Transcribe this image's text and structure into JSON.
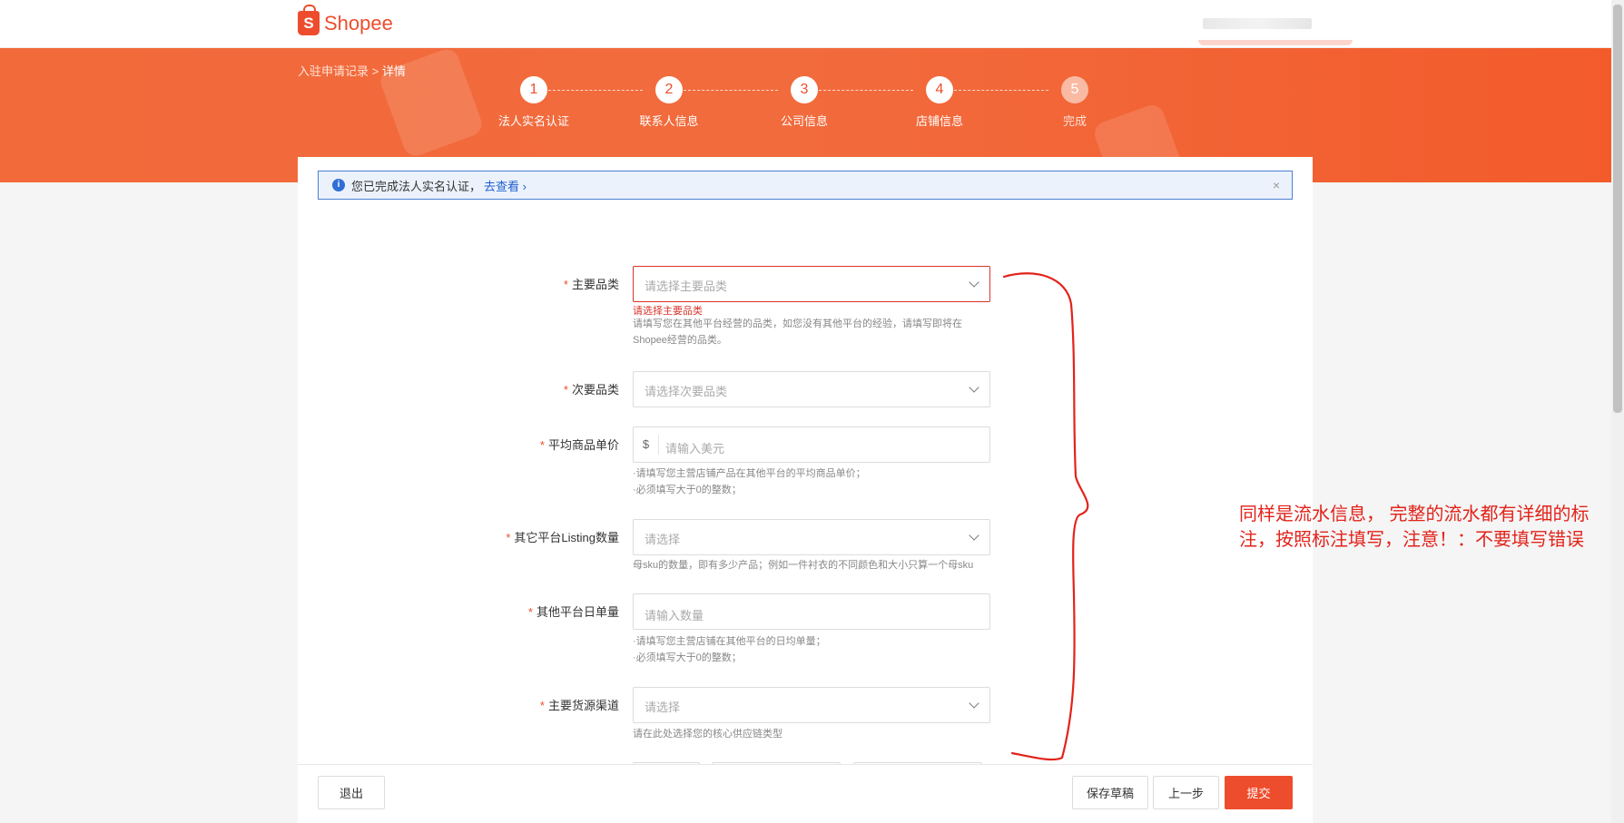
{
  "header": {
    "brand": "Shopee",
    "logo_letter": "S"
  },
  "breadcrumb": {
    "parent": "入驻申请记录",
    "separator": ">",
    "current": "详情"
  },
  "steps": [
    {
      "number": "1",
      "label": "法人实名认证"
    },
    {
      "number": "2",
      "label": "联系人信息"
    },
    {
      "number": "3",
      "label": "公司信息"
    },
    {
      "number": "4",
      "label": "店铺信息"
    },
    {
      "number": "5",
      "label": "完成"
    }
  ],
  "notice": {
    "icon": "info-icon",
    "text": "您已完成法人实名认证，",
    "link": "去查看",
    "link_arrow": "›",
    "close": "×"
  },
  "form": {
    "required_mark": "*",
    "main_category": {
      "label": "主要品类",
      "placeholder": "请选择主要品类",
      "error": "请选择主要品类",
      "hint": "请填写您在其他平台经营的品类，如您没有其他平台的经验，请填写即将在Shopee经营的品类。"
    },
    "secondary_category": {
      "label": "次要品类",
      "placeholder": "请选择次要品类"
    },
    "avg_price": {
      "label": "平均商品单价",
      "prefix": "$",
      "placeholder": "请输入美元",
      "hint1": "·请填写您主营店铺产品在其他平台的平均商品单价；",
      "hint2": "·必须填写大于0的整数；"
    },
    "listing_count": {
      "label": "其它平台Listing数量",
      "placeholder": "请选择",
      "hint": "母sku的数量，即有多少产品；例如一件衬衣的不同颜色和大小只算一个母sku"
    },
    "daily_orders": {
      "label": "其他平台日单量",
      "placeholder": "请输入数量",
      "hint1": "·请填写您主营店铺在其他平台的日均单量；",
      "hint2": "·必须填写大于0的整数；"
    },
    "supply_channel": {
      "label": "主要货源渠道",
      "placeholder": "请选择",
      "hint": "请在此处选择您的核心供应链类型"
    }
  },
  "footer": {
    "exit": "退出",
    "save_draft": "保存草稿",
    "prev": "上一步",
    "submit": "提交"
  },
  "annotation": {
    "text": "同样是流水信息， 完整的流水都有详细的标注，按照标注填写，注意！：不要填写错误"
  },
  "colors": {
    "brand": "#ee4d2d",
    "error": "#d9332a",
    "annotation": "#e2231a",
    "notice_border": "#4a7fd4"
  }
}
